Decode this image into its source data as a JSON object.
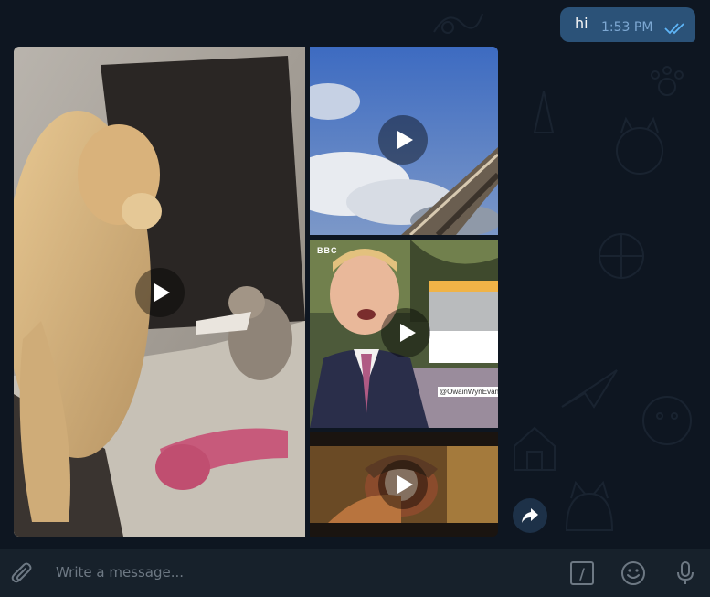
{
  "conversation": {
    "outgoing_message": {
      "text": "hi",
      "time": "1:53 PM",
      "status_icon": "double-check-icon",
      "bubble_color": "#2b5278"
    }
  },
  "album": {
    "videos": [
      {
        "icon": "play-icon",
        "subject": "dog-and-cat"
      },
      {
        "icon": "play-icon",
        "subject": "sky"
      },
      {
        "icon": "play-icon",
        "subject": "weather-presenter",
        "channel_tag": "BBC",
        "handle": "@OwainWynEvans"
      },
      {
        "icon": "play-icon",
        "subject": "film-scene"
      }
    ],
    "share_icon": "share-arrow-icon"
  },
  "composer": {
    "placeholder": "Write a message...",
    "attach_icon": "paperclip-icon",
    "commands_icon": "slash-command-icon",
    "emoji_icon": "emoji-icon",
    "voice_icon": "microphone-icon"
  },
  "theme": {
    "background": "#0e1621",
    "composer_background": "#17212b",
    "accent": "#5eb5f7"
  }
}
